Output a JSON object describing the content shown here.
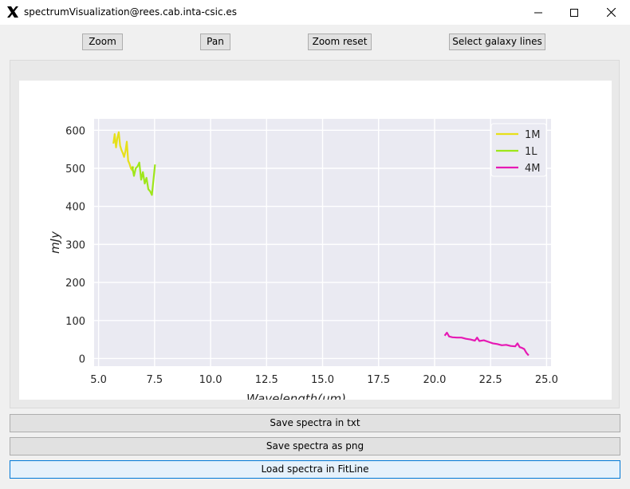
{
  "window": {
    "title": "spectrumVisualization@rees.cab.inta-csic.es",
    "app_icon": "x-logo-icon",
    "controls": [
      "minimize-icon",
      "maximize-icon",
      "close-icon"
    ]
  },
  "toolbar": {
    "zoom_label": "Zoom",
    "pan_label": "Pan",
    "zoom_reset_label": "Zoom reset",
    "select_lines_label": "Select galaxy lines"
  },
  "actions": {
    "save_txt_label": "Save spectra in txt",
    "save_png_label": "Save spectra as png",
    "load_fitline_label": "Load spectra in FitLine"
  },
  "colors": {
    "plot_bg": "#eaeaf2",
    "grid": "#ffffff",
    "1M": "#e6e01a",
    "1L": "#9ee61a",
    "4M": "#e619b4"
  },
  "chart_data": {
    "type": "line",
    "title": "",
    "xlabel": "Wavelength(μm)",
    "ylabel": "mJy",
    "xlim": [
      4.8,
      25.2
    ],
    "ylim": [
      -20,
      630
    ],
    "xticks": [
      5.0,
      7.5,
      10.0,
      12.5,
      15.0,
      17.5,
      20.0,
      22.5,
      25.0
    ],
    "yticks": [
      0,
      100,
      200,
      300,
      400,
      500,
      600
    ],
    "grid": true,
    "legend_position": "top-right",
    "series": [
      {
        "name": "1M",
        "x": [
          5.66,
          5.72,
          5.78,
          5.84,
          5.9,
          5.96,
          6.02,
          6.08,
          6.14,
          6.2,
          6.26,
          6.32,
          6.38,
          6.44,
          6.5,
          6.56
        ],
        "y": [
          565,
          590,
          555,
          580,
          595,
          560,
          548,
          540,
          530,
          545,
          570,
          520,
          512,
          500,
          495,
          505
        ]
      },
      {
        "name": "1L",
        "x": [
          6.5,
          6.58,
          6.66,
          6.74,
          6.82,
          6.9,
          6.98,
          7.06,
          7.14,
          7.22,
          7.3,
          7.38,
          7.46,
          7.52
        ],
        "y": [
          505,
          480,
          500,
          505,
          515,
          470,
          490,
          460,
          475,
          445,
          440,
          430,
          475,
          510
        ]
      },
      {
        "name": "4M",
        "x": [
          20.45,
          20.55,
          20.65,
          20.8,
          21.0,
          21.2,
          21.4,
          21.6,
          21.8,
          21.9,
          22.0,
          22.2,
          22.4,
          22.6,
          22.8,
          23.0,
          23.2,
          23.4,
          23.6,
          23.7,
          23.8,
          23.9,
          24.0,
          24.1,
          24.2
        ],
        "y": [
          60,
          68,
          58,
          56,
          55,
          55,
          52,
          50,
          47,
          55,
          46,
          48,
          44,
          40,
          38,
          35,
          36,
          33,
          32,
          40,
          30,
          28,
          25,
          15,
          8
        ]
      }
    ]
  }
}
